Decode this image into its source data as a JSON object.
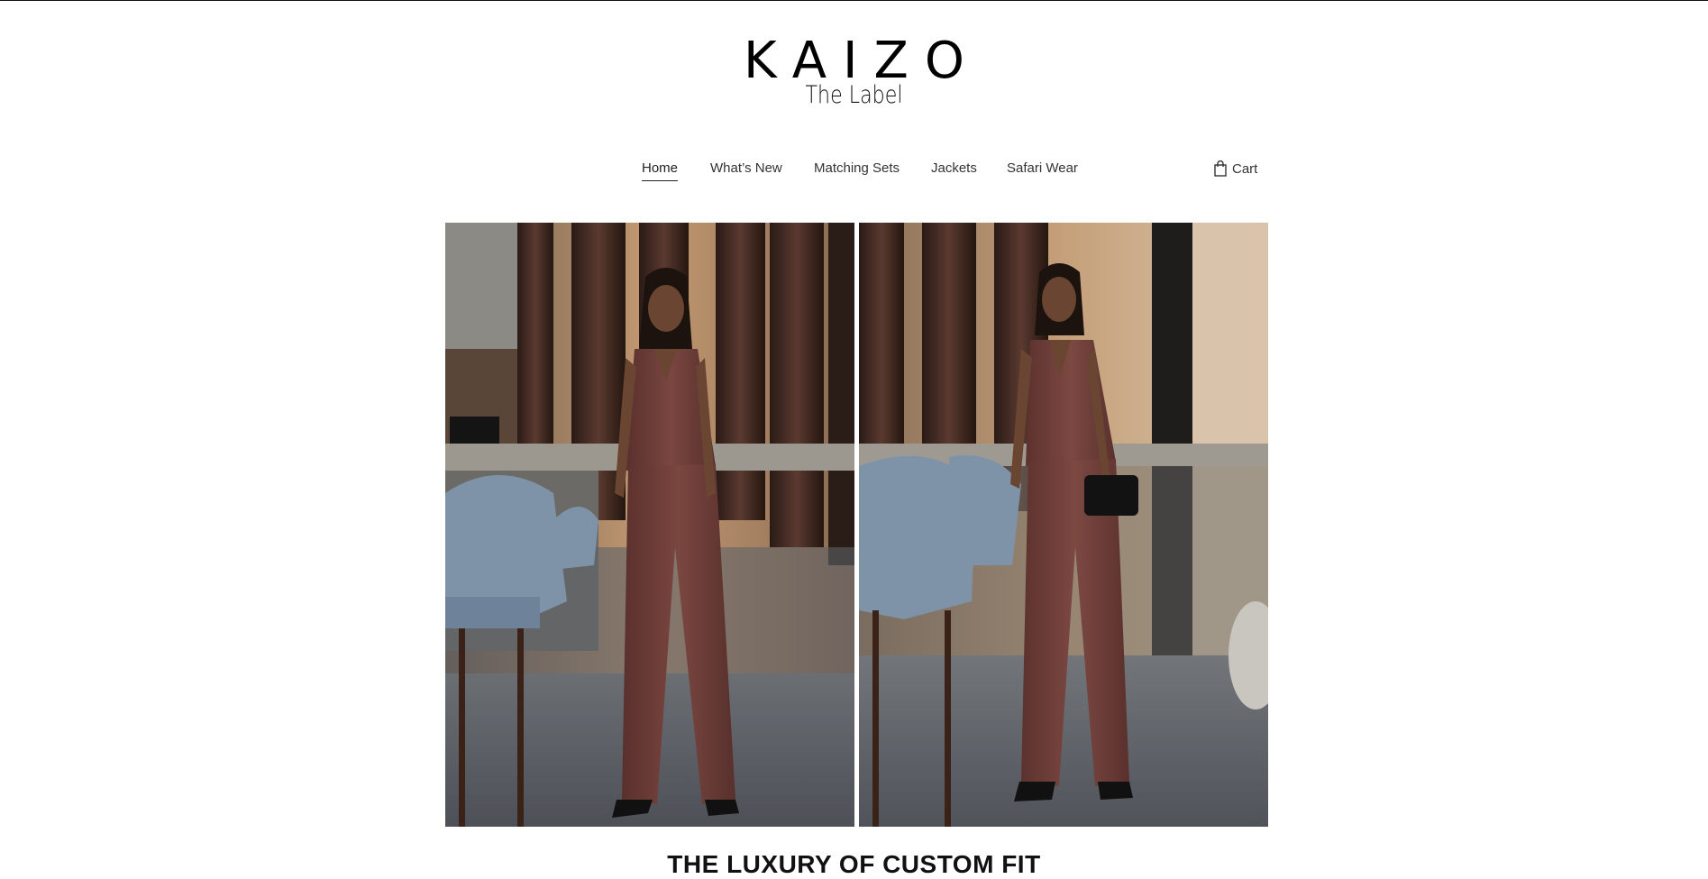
{
  "brand": {
    "name": "KAIZO",
    "subtitle": "The Label"
  },
  "nav": {
    "items": [
      {
        "label": "Home",
        "active": true
      },
      {
        "label": "What’s New",
        "active": false
      },
      {
        "label": "Matching Sets",
        "active": false
      },
      {
        "label": "Jackets",
        "active": false
      },
      {
        "label": "Safari Wear",
        "active": false
      }
    ],
    "cart_label": "Cart",
    "cart_icon": "shopping-bag-icon"
  },
  "hero": {
    "tagline": "THE LUXURY OF CUSTOM FIT"
  },
  "colors": {
    "suit": "#6b3a36",
    "chair": "#7f93a8",
    "pillar": "#3a2622",
    "floor": "#5e6268"
  }
}
